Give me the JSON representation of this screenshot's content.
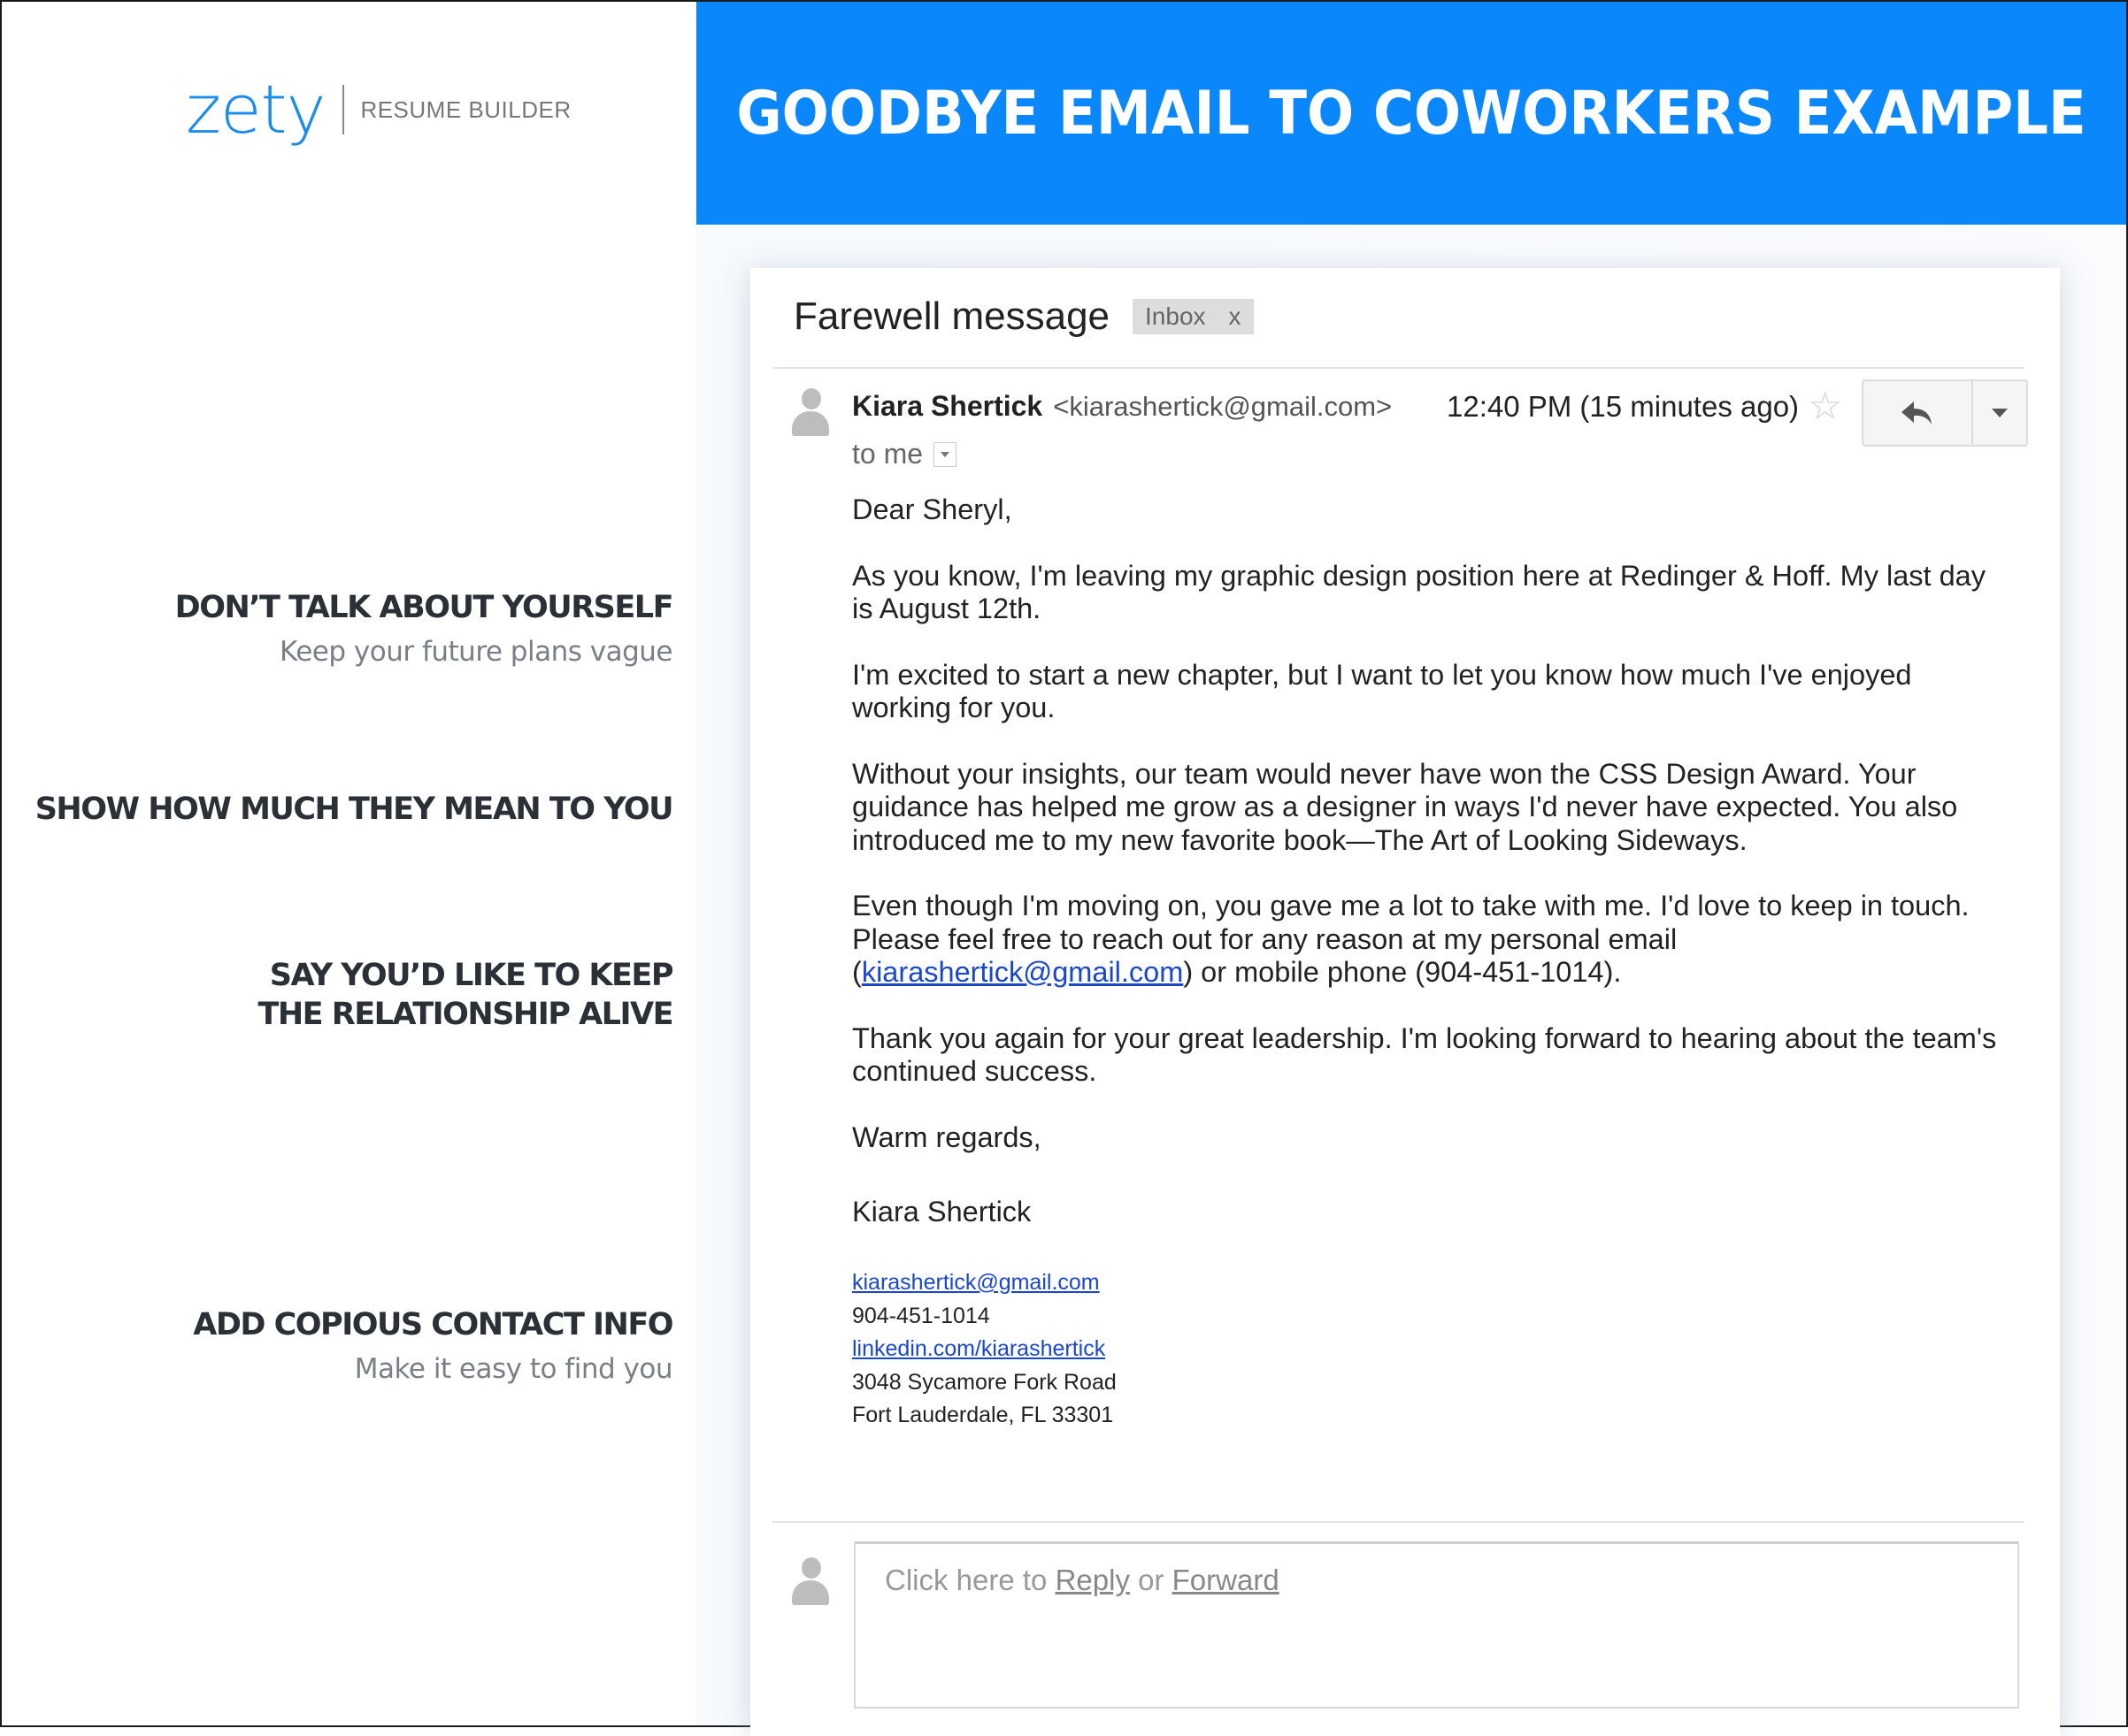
{
  "brand": {
    "logo_text": "zety",
    "tagline": "RESUME BUILDER",
    "accent_color": "#0a88fb"
  },
  "banner": {
    "title": "GOODBYE EMAIL TO COWORKERS EXAMPLE"
  },
  "tips": [
    {
      "title": "DON’T TALK ABOUT YOURSELF",
      "subtitle": "Keep your future plans vague"
    },
    {
      "title": "SHOW HOW MUCH THEY MEAN TO YOU",
      "subtitle": ""
    },
    {
      "title_line1": "SAY YOU’D LIKE TO KEEP",
      "title_line2": "THE RELATIONSHIP ALIVE",
      "subtitle": ""
    },
    {
      "title": "ADD COPIOUS CONTACT INFO",
      "subtitle": "Make it easy to find you"
    }
  ],
  "email": {
    "subject": "Farewell message",
    "label": "Inbox",
    "label_remove": "x",
    "sender_name": "Kiara Shertick",
    "sender_email": "<kiarashertick@gmail.com>",
    "time": "12:40 PM (15 minutes ago)",
    "star_icon": "star-outline-icon",
    "reply_icon": "reply-arrow-icon",
    "more_icon": "caret-down-icon",
    "recipient": "to me",
    "greeting": "Dear Sheryl,",
    "paragraphs": [
      "As you know, I'm leaving my graphic design position here at Redinger & Hoff. My last day is August 12th.",
      "I'm excited to start a new chapter, but I want to let you know how much I've enjoyed working for you.",
      "Without your insights, our team would never have won the CSS Design Award. Your guidance has helped me grow as a designer in ways I'd never have expected. You also introduced me to my new favorite book—The Art of Looking Sideways."
    ],
    "keep_in_touch": {
      "before": "Even though I'm moving on, you gave me a lot to take with me. I'd love to keep in touch.  Please feel free to reach out for any reason at my personal email (",
      "email_link": "kiarashertick@gmail.com",
      "after": ") or mobile phone (904-451-1014)."
    },
    "thanks": "Thank you again for your great leadership. I'm looking forward to hearing about the team's continued success.",
    "closing": "Warm regards,",
    "signature_name": "Kiara Shertick",
    "contact": {
      "email": "kiarashertick@gmail.com",
      "phone": "904-451-1014",
      "linkedin": "linkedin.com/kiarashertick",
      "address_line1": "3048 Sycamore Fork Road",
      "address_line2": "Fort Lauderdale, FL 33301"
    },
    "reply_box": {
      "prefix": "Click here to ",
      "reply_link": "Reply",
      "middle": " or ",
      "forward_link": "Forward"
    }
  }
}
